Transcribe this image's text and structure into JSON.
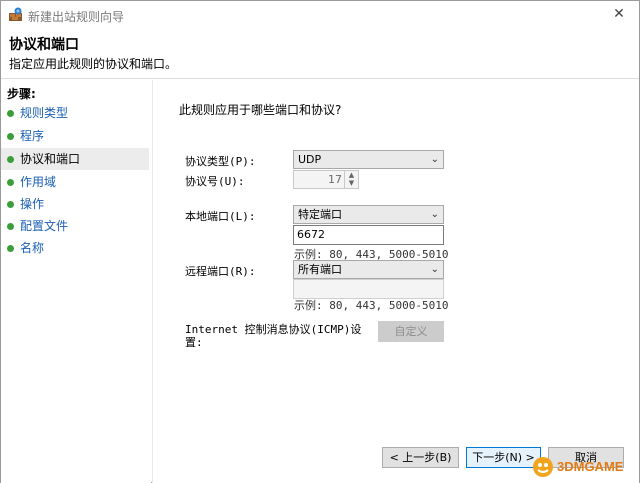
{
  "window": {
    "title": "新建出站规则向导",
    "close_glyph": "✕"
  },
  "header": {
    "title": "协议和端口",
    "subtitle": "指定应用此规则的协议和端口。"
  },
  "steps": {
    "title": "步骤:",
    "items": [
      {
        "label": "规则类型"
      },
      {
        "label": "程序"
      },
      {
        "label": "协议和端口"
      },
      {
        "label": "作用域"
      },
      {
        "label": "操作"
      },
      {
        "label": "配置文件"
      },
      {
        "label": "名称"
      }
    ],
    "active_index": 2
  },
  "main": {
    "question": "此规则应用于哪些端口和协议?",
    "protocol_type": {
      "label": "协议类型(P):",
      "value": "UDP"
    },
    "protocol_number": {
      "label": "协议号(U):",
      "value": "17"
    },
    "local_port": {
      "label": "本地端口(L):",
      "value": "特定端口",
      "input": "6672",
      "example": "示例: 80, 443, 5000-5010"
    },
    "remote_port": {
      "label": "远程端口(R):",
      "value": "所有端口",
      "input": "",
      "example": "示例: 80, 443, 5000-5010"
    },
    "icmp": {
      "label_line1": "Internet 控制消息协议(ICMP)设",
      "label_line2": "置:",
      "button": "自定义"
    }
  },
  "footer": {
    "back": "< 上一步(B)",
    "next": "下一步(N) >",
    "cancel": "取消"
  },
  "watermark": {
    "text": "3DMGAME"
  },
  "icons": {
    "app": "firewall-icon",
    "close": "close-icon",
    "step_dot": "green-dot-icon",
    "chevron": "chevron-down-icon",
    "spin": "spin-updown-icon"
  }
}
